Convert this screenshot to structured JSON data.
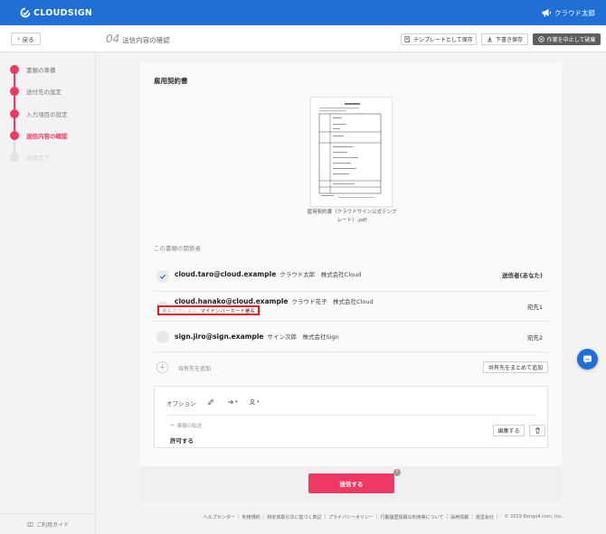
{
  "app": {
    "brand": "CLOUDSIGN",
    "user": "クラウド太郎"
  },
  "header": {
    "back_label": "戻る",
    "step_no": "04",
    "step_label": "送信内容の確認",
    "save_template": "テンプレートとして保存",
    "save_draft": "下書き保存",
    "abort": "作業を中止して破棄"
  },
  "sidebar": {
    "steps": [
      {
        "label": "書類の準備",
        "state": "done"
      },
      {
        "label": "送付先の設定",
        "state": "done"
      },
      {
        "label": "入力項目の設定",
        "state": "done"
      },
      {
        "label": "送信内容の確認",
        "state": "active"
      },
      {
        "label": "送信完了",
        "state": "disabled"
      }
    ],
    "guide": "ご利用ガイド"
  },
  "document": {
    "title": "雇用契約書",
    "file_name": "雇用契約書（クラウドサイン公式テンプレート）.pdf"
  },
  "parties": {
    "section_label": "この書類の関係者",
    "rows": [
      {
        "email": "cloud.taro@cloud.example",
        "meta": "クラウド太郎　株式会社Cloud",
        "role": "送信者(あなた)",
        "checked": true
      },
      {
        "email": "cloud.hanako@cloud.example",
        "meta": "クラウド花子　株式会社Cloud",
        "role": "宛先1",
        "checked": false,
        "option_key": "署名オプション",
        "option_value": "マイナンバーカード署名"
      },
      {
        "email": "sign.jiro@sign.example",
        "meta": "サイン次郎　株式会社Sign",
        "role": "宛先2",
        "checked": false
      }
    ],
    "add_label": "共有先を追加",
    "bulk_add": "共有先をまとめて追加"
  },
  "options": {
    "title": "オプション",
    "forward_label": "書類の転送",
    "forward_value": "許可する",
    "edit": "編集する"
  },
  "send": {
    "label": "送信する",
    "help": "?"
  },
  "footer": {
    "links": [
      "ヘルプセンター",
      "利用規約",
      "特定商取引法に基づく表記",
      "プライバシーポリシー",
      "行動履歴情報の利用等について",
      "採用情報",
      "運営会社"
    ],
    "copyright": "© 2019 Bengo4.com, Inc."
  },
  "colors": {
    "brand": "#1f6fd6",
    "accent": "#ee3964",
    "highlight": "#e01c1c"
  }
}
